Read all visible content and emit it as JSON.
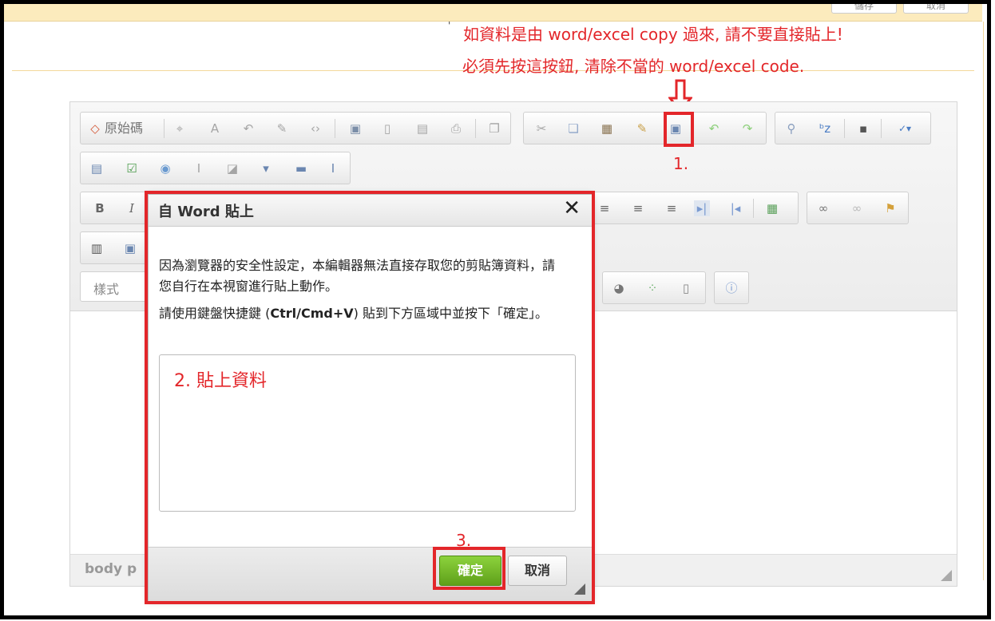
{
  "top": {
    "buttons": [
      "儲存",
      "取消"
    ]
  },
  "annotations": {
    "line1": "如資料是由 word/excel copy 過來, 請不要直接貼上!",
    "line2": "必須先按這按鈕, 清除不當的 word/excel code.",
    "step1": "1.",
    "step2": "2. 貼上資料",
    "step3": "3.",
    "tick": "'"
  },
  "toolbar": {
    "source_label": "原始碼",
    "style_placeholder": "樣式",
    "row1_icons": [
      "source-icon",
      "find-icon",
      "select-all-icon",
      "undo-style-icon",
      "templates-icon",
      "code-icon",
      "save-icon",
      "new-page-icon",
      "preview-icon",
      "print-icon",
      "copy-format-icon",
      "cut-icon",
      "copy-icon",
      "paste-icon",
      "paste-text-icon",
      "paste-from-word-icon",
      "undo-icon",
      "redo-icon",
      "find-replace-icon",
      "spellcheck-bz-icon",
      "maximize-icon",
      "spellcheck-abc-icon"
    ],
    "row2_icons": [
      "form-icon",
      "checkbox-icon",
      "radio-icon",
      "textfield-icon",
      "textarea-icon",
      "select-icon",
      "button-icon",
      "hidden-field-icon"
    ],
    "row3_icons": [
      "bold-icon",
      "italic-icon",
      "align-left-icon",
      "align-right-icon",
      "justify-icon",
      "ltr-icon",
      "rtl-icon",
      "language-icon",
      "link-icon",
      "unlink-icon",
      "anchor-icon"
    ],
    "row4_icons": [
      "flash-icon",
      "image-icon"
    ],
    "row5_icons": [
      "chart-icon",
      "show-blocks-icon",
      "fullscreen-icon",
      "about-icon"
    ]
  },
  "statusbar": {
    "path": "body  p"
  },
  "dialog": {
    "title": "自 Word 貼上",
    "close": "✕",
    "para1": "因為瀏覽器的安全性設定，本編輯器無法直接存取您的剪貼簿資料，請您自行在本視窗進行貼上動作。",
    "para2_pre": "請使用鍵盤快捷鍵 (",
    "para2_key": "Ctrl/Cmd+V",
    "para2_post": ") 貼到下方區域中並按下「確定」。",
    "ok_label": "確定",
    "cancel_label": "取消"
  },
  "colors": {
    "annotation_red": "#e3262a",
    "ok_green": "#6cb027",
    "top_yellow": "#fcebbd"
  }
}
